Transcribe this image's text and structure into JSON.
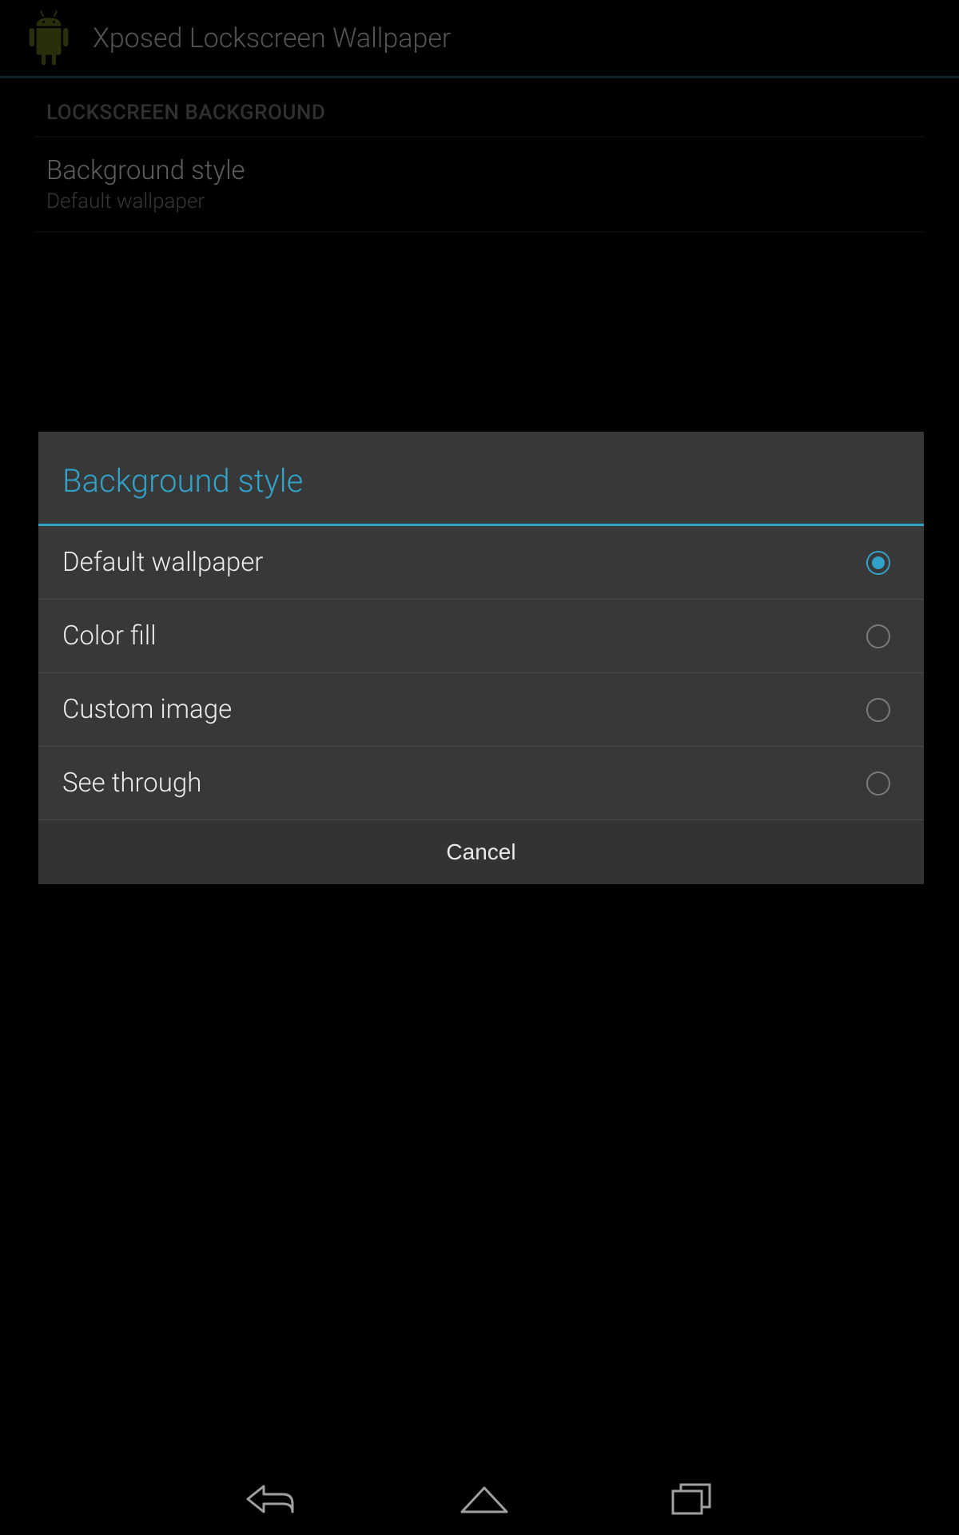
{
  "header": {
    "app_title": "Xposed Lockscreen Wallpaper"
  },
  "settings": {
    "section_header": "LOCKSCREEN BACKGROUND",
    "background_style": {
      "title": "Background style",
      "summary": "Default wallpaper"
    }
  },
  "dialog": {
    "title": "Background style",
    "options": [
      {
        "label": "Default wallpaper",
        "selected": true
      },
      {
        "label": "Color fill",
        "selected": false
      },
      {
        "label": "Custom image",
        "selected": false
      },
      {
        "label": "See through",
        "selected": false
      }
    ],
    "cancel_label": "Cancel"
  },
  "colors": {
    "accent": "#31a2c8",
    "dialog_bg": "#383838"
  }
}
